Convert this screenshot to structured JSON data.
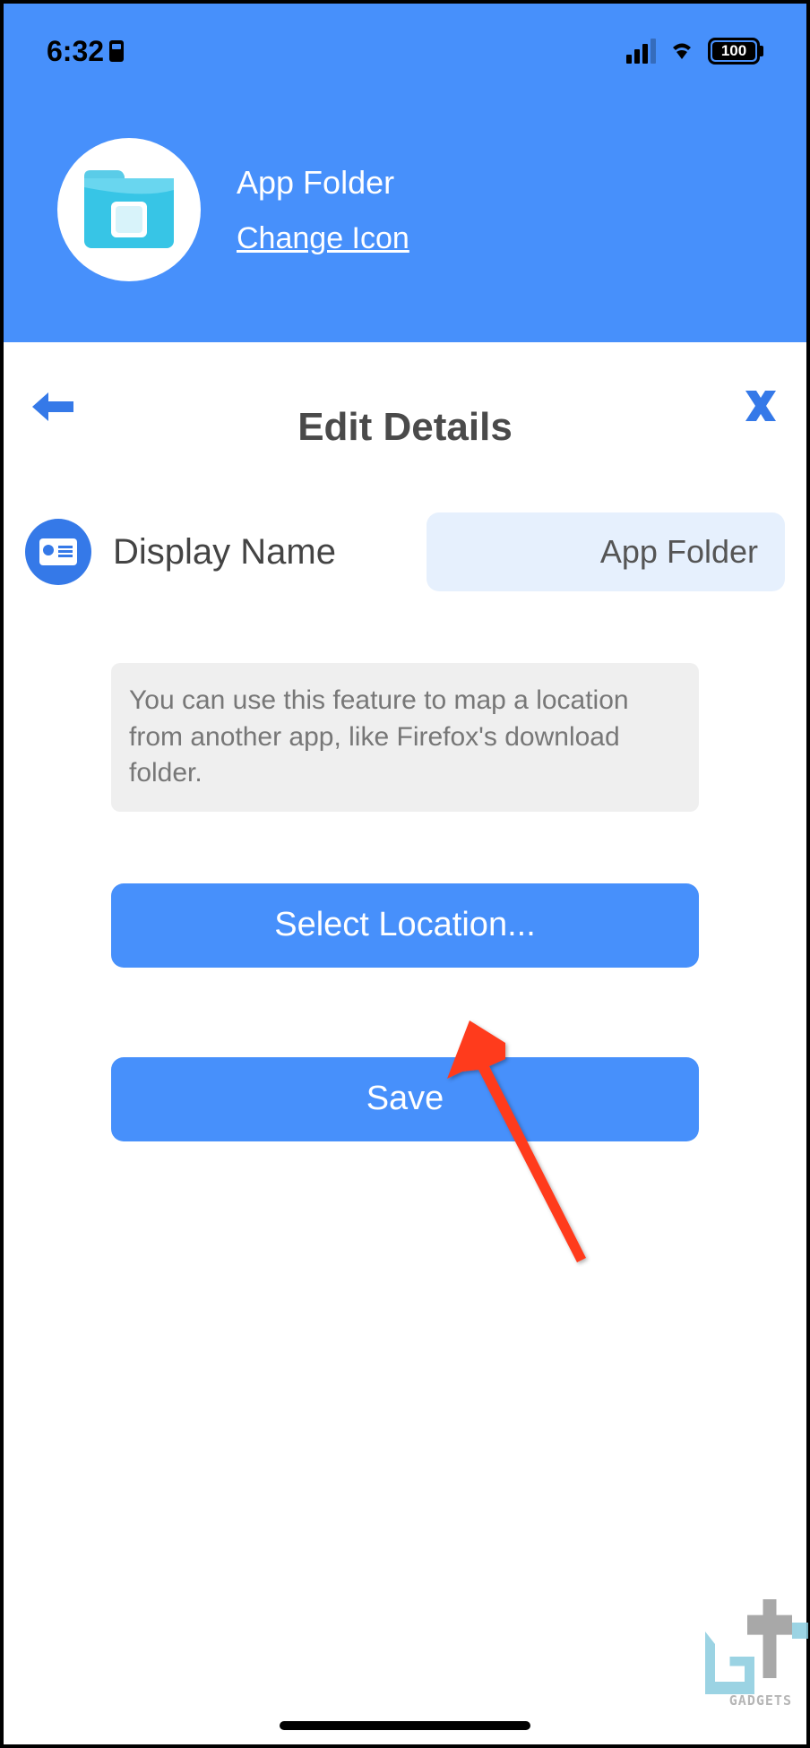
{
  "statusBar": {
    "time": "6:32",
    "battery": "100"
  },
  "header": {
    "title": "App Folder",
    "changeIconLink": "Change Icon"
  },
  "page": {
    "title": "Edit Details"
  },
  "form": {
    "displayNameLabel": "Display Name",
    "displayNameValue": "App Folder",
    "infoText": "You can use this feature to map a location from another app, like Firefox's download folder."
  },
  "buttons": {
    "selectLocation": "Select Location...",
    "save": "Save"
  },
  "watermark": {
    "text": "GADGETS"
  }
}
